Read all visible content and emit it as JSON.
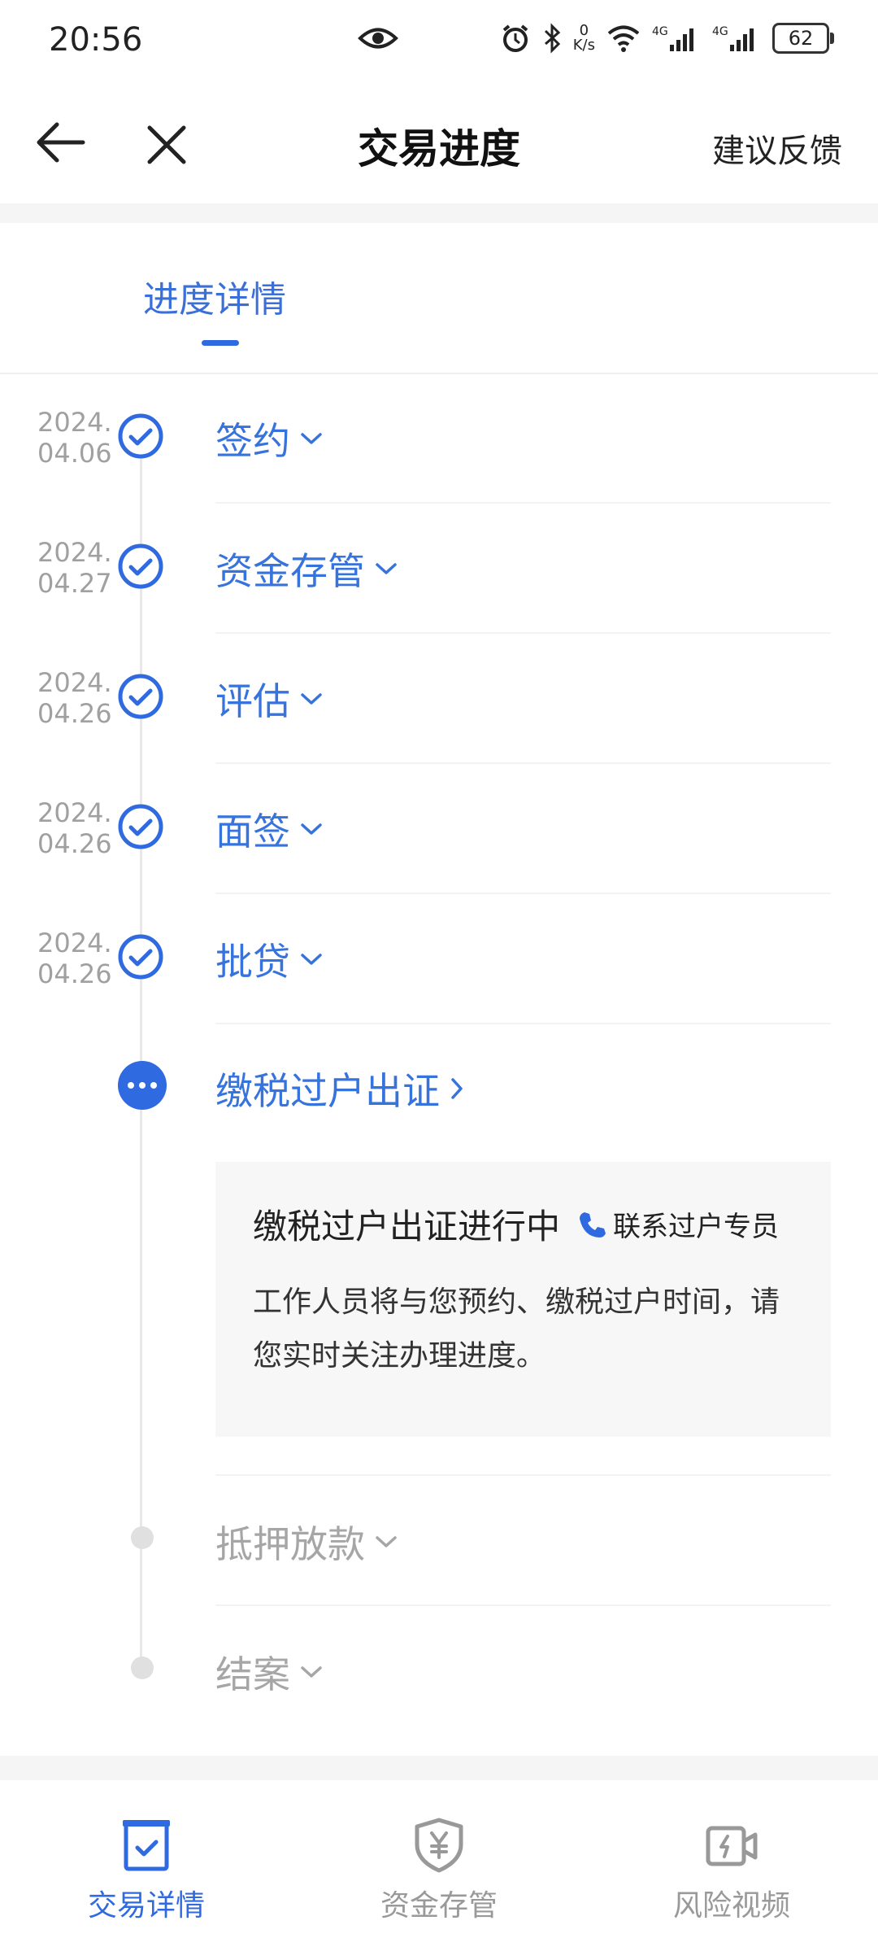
{
  "status_bar": {
    "time": "20:56",
    "net_speed_value": "0",
    "net_speed_unit": "K/s",
    "battery": "62",
    "icons": [
      "eye-icon",
      "alarm-icon",
      "bluetooth-icon",
      "wifi-icon",
      "signal-4g-icon",
      "signal-4g-icon"
    ]
  },
  "header": {
    "title": "交易进度",
    "feedback": "建议反馈"
  },
  "tabs": {
    "active": "进度详情"
  },
  "steps": [
    {
      "date_line1": "2024.",
      "date_line2": "04.06",
      "title": "签约",
      "state": "done"
    },
    {
      "date_line1": "2024.",
      "date_line2": "04.27",
      "title": "资金存管",
      "state": "done"
    },
    {
      "date_line1": "2024.",
      "date_line2": "04.26",
      "title": "评估",
      "state": "done"
    },
    {
      "date_line1": "2024.",
      "date_line2": "04.26",
      "title": "面签",
      "state": "done"
    },
    {
      "date_line1": "2024.",
      "date_line2": "04.26",
      "title": "批贷",
      "state": "done"
    },
    {
      "title": "缴税过户出证",
      "state": "current"
    },
    {
      "title": "抵押放款",
      "state": "pending"
    },
    {
      "title": "结案",
      "state": "pending"
    }
  ],
  "current_card": {
    "status": "缴税过户出证进行中",
    "contact": "联系过户专员",
    "desc": "工作人员将与您预约、缴税过户时间，请您实时关注办理进度。"
  },
  "bottom_nav": [
    {
      "label": "交易详情",
      "icon": "clipboard-check-icon",
      "active": true
    },
    {
      "label": "资金存管",
      "icon": "yuan-shield-icon",
      "active": false
    },
    {
      "label": "风险视频",
      "icon": "video-icon",
      "active": false
    }
  ],
  "colors": {
    "accent": "#2f6ae0",
    "done_text": "#3673dc",
    "pending": "#a6a6a6"
  }
}
